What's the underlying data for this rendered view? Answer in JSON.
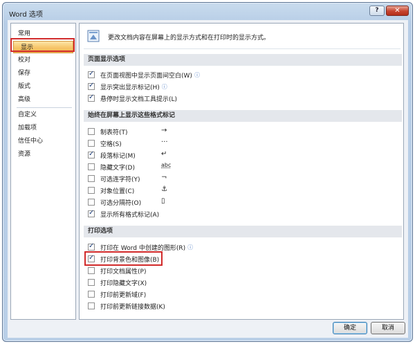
{
  "window": {
    "title": "Word 选项",
    "help": "?",
    "close": "✕"
  },
  "sidebar": {
    "items": [
      {
        "label": "常用"
      },
      {
        "label": "显示"
      },
      {
        "label": "校对"
      },
      {
        "label": "保存"
      },
      {
        "label": "版式"
      },
      {
        "label": "高级"
      },
      {
        "label": "自定义"
      },
      {
        "label": "加载项"
      },
      {
        "label": "信任中心"
      },
      {
        "label": "资源"
      }
    ],
    "selected": "显示"
  },
  "header": {
    "text": "更改文档内容在屏幕上的显示方式和在打印时的显示方式。"
  },
  "page_display": {
    "title": "页面显示选项",
    "options": [
      {
        "label": "在页面视图中显示页面间空白(W)",
        "checked": true,
        "info": "ⓘ"
      },
      {
        "label": "显示突出显示标记(H)",
        "checked": true,
        "info": "ⓘ"
      },
      {
        "label": "悬停时显示文档工具提示(L)",
        "checked": true
      }
    ]
  },
  "format_marks": {
    "title": "始终在屏幕上显示这些格式标记",
    "options": [
      {
        "label": "制表符(T)",
        "checked": false,
        "mark": "→"
      },
      {
        "label": "空格(S)",
        "checked": false,
        "mark": "···"
      },
      {
        "label": "段落标记(M)",
        "checked": true,
        "mark": "↵"
      },
      {
        "label": "隐藏文字(D)",
        "checked": false,
        "mark": "abc"
      },
      {
        "label": "可选连字符(Y)",
        "checked": false,
        "mark": "¬"
      },
      {
        "label": "对象位置(C)",
        "checked": false,
        "mark": "⚓"
      },
      {
        "label": "可选分隔符(O)",
        "checked": false,
        "mark": "▯"
      },
      {
        "label": "显示所有格式标记(A)",
        "checked": true
      }
    ]
  },
  "print_options": {
    "title": "打印选项",
    "options": [
      {
        "label": "打印在 Word 中创建的图形(R)",
        "checked": true,
        "info": "ⓘ"
      },
      {
        "label": "打印背景色和图像(B)",
        "checked": true
      },
      {
        "label": "打印文档属性(P)",
        "checked": false
      },
      {
        "label": "打印隐藏文字(X)",
        "checked": false
      },
      {
        "label": "打印前更新域(F)",
        "checked": false
      },
      {
        "label": "打印前更新链接数据(K)",
        "checked": false
      }
    ]
  },
  "buttons": {
    "ok": "确定",
    "cancel": "取消"
  },
  "icons": {
    "header": "display-settings-icon"
  },
  "colors": {
    "highlight": "#d12a2a",
    "selected_nav": "#f7c86e"
  }
}
